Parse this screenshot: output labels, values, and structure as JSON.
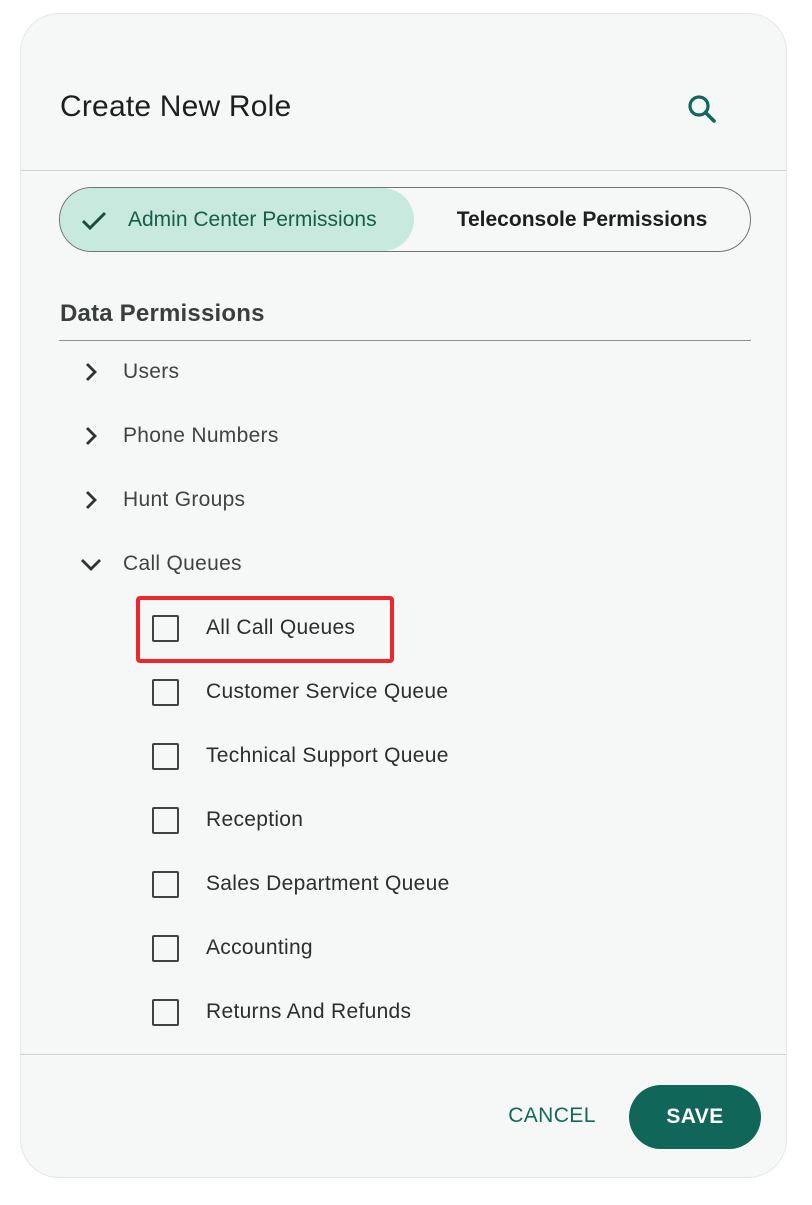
{
  "dialog": {
    "title": "Create New Role",
    "search_icon": "search-icon"
  },
  "tabs": {
    "admin": {
      "label": "Admin Center Permissions",
      "selected": true,
      "icon": "check-icon"
    },
    "teleconsole": {
      "label": "Teleconsole Permissions",
      "selected": false
    }
  },
  "section": {
    "title": "Data Permissions"
  },
  "tree": [
    {
      "label": "Users",
      "expanded": false
    },
    {
      "label": "Phone Numbers",
      "expanded": false
    },
    {
      "label": "Hunt Groups",
      "expanded": false
    },
    {
      "label": "Call Queues",
      "expanded": true
    }
  ],
  "call_queues": [
    {
      "label": "All Call Queues",
      "checked": false
    },
    {
      "label": "Customer Service Queue",
      "checked": false
    },
    {
      "label": "Technical Support Queue",
      "checked": false
    },
    {
      "label": "Reception",
      "checked": false
    },
    {
      "label": "Sales Department Queue",
      "checked": false
    },
    {
      "label": "Accounting",
      "checked": false
    },
    {
      "label": "Returns And Refunds",
      "checked": false
    }
  ],
  "footer": {
    "cancel_label": "CANCEL",
    "save_label": "SAVE"
  },
  "colors": {
    "accent": "#0f6659",
    "selected_tab_bg": "#c8e9dd",
    "highlight": "#f0262d",
    "surface": "#f6f8f7"
  }
}
